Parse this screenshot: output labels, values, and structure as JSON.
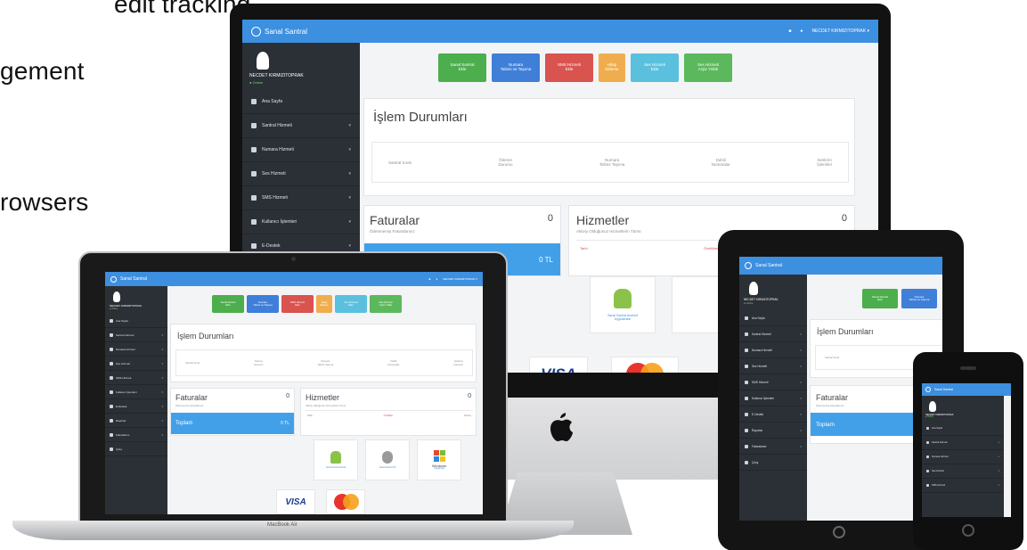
{
  "slide": {
    "lines": [
      "edit tracking",
      "gement",
      "rowsers"
    ]
  },
  "app": {
    "title": "Sanal Santral",
    "user_name": "NECDET KIRMIZITOPRAK",
    "user_status": "● Online",
    "topbar_user": "NECDET KIRMIZITOPRAK ▾",
    "nav": [
      {
        "label": "Ana Sayfa",
        "caret": false
      },
      {
        "label": "Santral Hizmeti",
        "caret": true
      },
      {
        "label": "Numara Hizmeti",
        "caret": true
      },
      {
        "label": "Ses Hizmeti",
        "caret": true
      },
      {
        "label": "SMS Hizmeti",
        "caret": true
      },
      {
        "label": "Kullanıcı İşlemleri",
        "caret": true
      },
      {
        "label": "E-Destek",
        "caret": true
      },
      {
        "label": "Raporlar",
        "caret": true
      },
      {
        "label": "Faturalarım",
        "caret": true
      },
      {
        "label": "Çıkış",
        "caret": false
      }
    ],
    "actions": [
      {
        "line1": "Sanal Santral",
        "line2": "Ekle",
        "color": "#4cae4c"
      },
      {
        "line1": "Numara",
        "line2": "Tahsis ve Taşıma",
        "color": "#3f7fd8"
      },
      {
        "line1": "SMS Hizmeti",
        "line2": "Ekle",
        "color": "#d9534f"
      },
      {
        "line1": "Hitap",
        "line2": "Ekleme",
        "color": "#f0ad4e"
      },
      {
        "line1": "Ses Hizmeti",
        "line2": "Ekle",
        "color": "#5bc0de"
      },
      {
        "line1": "Ses Hizmeti",
        "line2": "Arşiv Yükle",
        "color": "#5cb85c"
      }
    ],
    "status_title": "İşlem Durumları",
    "status_cols": [
      {
        "line1": "",
        "line2": "Santral Sıralı"
      },
      {
        "line1": "Ödeme",
        "line2": "Durumu"
      },
      {
        "line1": "Numara",
        "line2": "Tahsis Taşıma"
      },
      {
        "line1": "Dahili",
        "line2": "Numaralar"
      },
      {
        "line1": "Seslerin",
        "line2": "İşlemleri"
      }
    ],
    "invoices": {
      "title": "Faturalar",
      "count": "0",
      "subtitle": "Ödenmemiş Faturalarınız",
      "total_label": "Toplam",
      "total_value": "0 TL"
    },
    "services": {
      "title": "Hizmetler",
      "count": "0",
      "subtitle": "Aktiviy Olduğunuz Hizmetlerin Tümü",
      "col1": "Tarih",
      "col2": "Özellikler",
      "col3": "Durum"
    },
    "downloads": [
      {
        "line1": "Sanal Santral Android",
        "line2": "Uygulaması"
      },
      {
        "line1": "Sanal Santral iOS",
        "line2": "Uygulaması"
      },
      {
        "line1": "Windows",
        "line2": "Uygulaması"
      }
    ],
    "os_labels": [
      "Windows"
    ],
    "payments": [
      "VISA",
      "MasterCard"
    ]
  },
  "devices": {
    "laptop_label": "MacBook Air"
  },
  "colors": {
    "topbar": "#3d8fe0",
    "sidebar": "#2b2f36",
    "accent_blue": "#42a0e8"
  }
}
